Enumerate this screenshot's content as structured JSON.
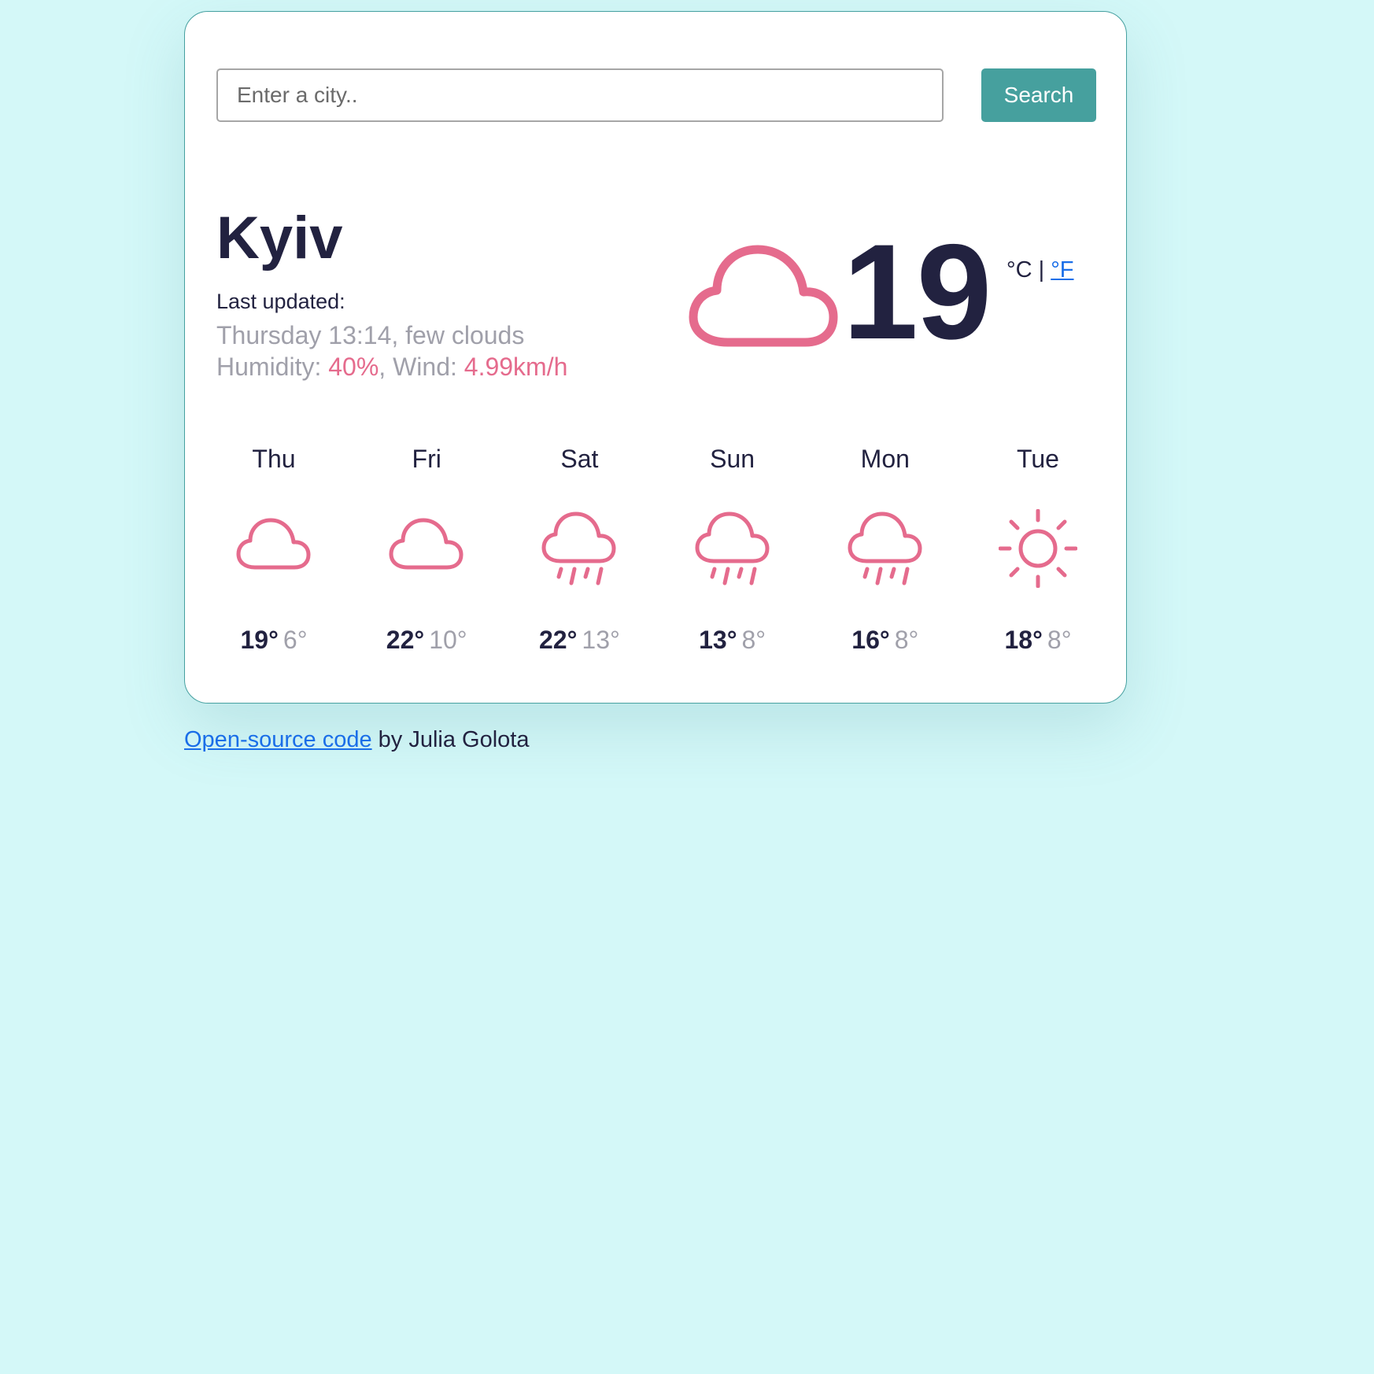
{
  "search": {
    "placeholder": "Enter a city..",
    "value": "",
    "button_label": "Search"
  },
  "current": {
    "city": "Kyiv",
    "last_updated_label": "Last updated:",
    "datetime_description": "Thursday 13:14, few clouds",
    "humidity_label": "Humidity: ",
    "humidity_value": "40%",
    "separator": ", ",
    "wind_label": "Wind: ",
    "wind_value": "4.99km/h",
    "icon": "cloud-icon",
    "temperature": "19",
    "unit_celsius": "°C",
    "unit_divider": " | ",
    "unit_fahrenheit": "°F"
  },
  "forecast": [
    {
      "day": "Thu",
      "icon": "cloud-icon",
      "max": "19°",
      "min": "6°"
    },
    {
      "day": "Fri",
      "icon": "cloud-icon",
      "max": "22°",
      "min": "10°"
    },
    {
      "day": "Sat",
      "icon": "rain-icon",
      "max": "22°",
      "min": "13°"
    },
    {
      "day": "Sun",
      "icon": "rain-icon",
      "max": "13°",
      "min": "8°"
    },
    {
      "day": "Mon",
      "icon": "rain-icon",
      "max": "16°",
      "min": "8°"
    },
    {
      "day": "Tue",
      "icon": "sun-icon",
      "max": "18°",
      "min": "8°"
    }
  ],
  "footer": {
    "link_text": "Open-source code",
    "author_text": " by Julia Golota"
  },
  "colors": {
    "background": "#d4f8f8",
    "accent": "#e56b8d",
    "button": "#46a09e",
    "text_dark": "#222240",
    "text_muted": "#a0a0aa",
    "link": "#1a6ee8"
  }
}
